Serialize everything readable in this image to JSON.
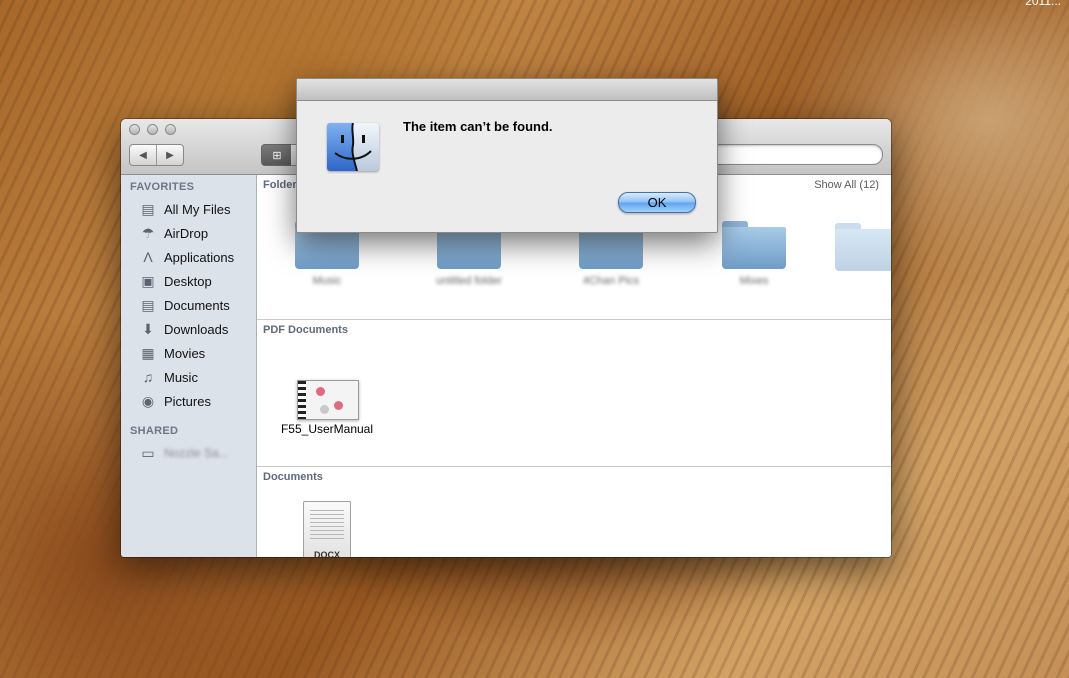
{
  "menubar": {
    "clock": "2011..."
  },
  "finder": {
    "sidebar": {
      "favorites_header": "FAVORITES",
      "items": [
        {
          "label": "All My Files",
          "icon": "all-files-icon"
        },
        {
          "label": "AirDrop",
          "icon": "airdrop-icon"
        },
        {
          "label": "Applications",
          "icon": "applications-icon"
        },
        {
          "label": "Desktop",
          "icon": "desktop-icon"
        },
        {
          "label": "Documents",
          "icon": "documents-icon"
        },
        {
          "label": "Downloads",
          "icon": "downloads-icon"
        },
        {
          "label": "Movies",
          "icon": "movies-icon"
        },
        {
          "label": "Music",
          "icon": "music-icon"
        },
        {
          "label": "Pictures",
          "icon": "pictures-icon"
        }
      ],
      "shared_header": "SHARED",
      "shared_item": "Nozzle Sa..."
    },
    "sections": {
      "folders": {
        "title": "Folders",
        "show_all": "Show All (12)",
        "items": [
          "Music",
          "untitled folder",
          "4Chan Pics",
          "Mixes"
        ]
      },
      "pdf": {
        "title": "PDF Documents",
        "file": "F55_UserManual"
      },
      "documents": {
        "title": "Documents",
        "file_type": "DOCX"
      }
    }
  },
  "alert": {
    "message": "The item can’t be found.",
    "ok_label": "OK"
  }
}
